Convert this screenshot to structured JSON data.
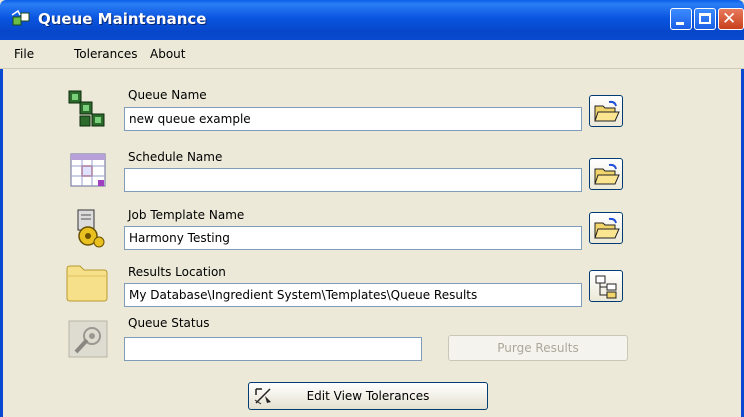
{
  "window": {
    "title": "Queue Maintenance"
  },
  "menu": {
    "file": "File",
    "tolerances": "Tolerances",
    "about": "About"
  },
  "queue_name": {
    "label": "Queue Name",
    "value": "new queue example"
  },
  "schedule_name": {
    "label": "Schedule Name",
    "value": ""
  },
  "job_template_name": {
    "label": "Job Template Name",
    "value": "Harmony Testing"
  },
  "results_location": {
    "label": "Results Location",
    "value": "My Database\\Ingredient System\\Templates\\Queue Results"
  },
  "queue_status": {
    "label": "Queue Status",
    "value": ""
  },
  "buttons": {
    "purge_results": "Purge Results",
    "edit_view_tolerances": "Edit View Tolerances"
  },
  "colors": {
    "titlebar": "#0a55e0",
    "dialog_bg": "#ece9d8",
    "field_border": "#7f9db9",
    "button_border": "#003c74"
  },
  "icons": {
    "app": "queue-app-icon",
    "queue": "queue-blocks-icon",
    "schedule": "calendar-icon",
    "job_template": "gear-document-icon",
    "results": "folder-icon",
    "status": "gray-status-icon",
    "browse": "open-folder-icon",
    "tree": "tree-browse-icon",
    "tolerances": "tolerances-icon"
  }
}
